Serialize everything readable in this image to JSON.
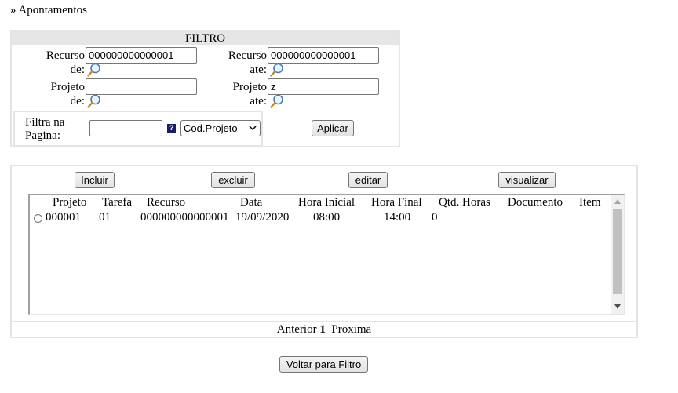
{
  "page": {
    "title": "» Apontamentos"
  },
  "filter": {
    "heading": "FILTRO",
    "recurso_de": {
      "label": "Recurso de:",
      "value": "000000000000001"
    },
    "recurso_ate": {
      "label": "Recurso ate:",
      "value": "000000000000001"
    },
    "projeto_de": {
      "label": "Projeto de:",
      "value": ""
    },
    "projeto_ate": {
      "label": "Projeto ate:",
      "value": "z"
    },
    "filtra_label": "Filtra na Pagina:",
    "filtra_value": "",
    "help_glyph": "?",
    "select_value": "Cod.Projeto",
    "apply_label": "Aplicar"
  },
  "toolbar": {
    "incluir": "Incluir",
    "excluir": "excluir",
    "editar": "editar",
    "visualizar": "visualizar"
  },
  "grid": {
    "columns": [
      "Projeto",
      "Tarefa",
      "Recurso",
      "Data",
      "Hora Inicial",
      "Hora Final",
      "Qtd. Horas",
      "Documento",
      "Item"
    ],
    "rows": [
      {
        "projeto": "000001",
        "tarefa": "01",
        "recurso": "000000000000001",
        "data": "19/09/2020",
        "hora_inicial": "08:00",
        "hora_final": "14:00",
        "qtd_horas": "0",
        "documento": "",
        "item": ""
      }
    ]
  },
  "pager": {
    "prev": "Anterior",
    "current": "1",
    "next": "Proxima"
  },
  "footer": {
    "back_label": "Voltar para Filtro"
  },
  "icons": {
    "lookup": "magnifier-icon",
    "help": "help-icon",
    "dropdown": "chevron-down-icon"
  }
}
